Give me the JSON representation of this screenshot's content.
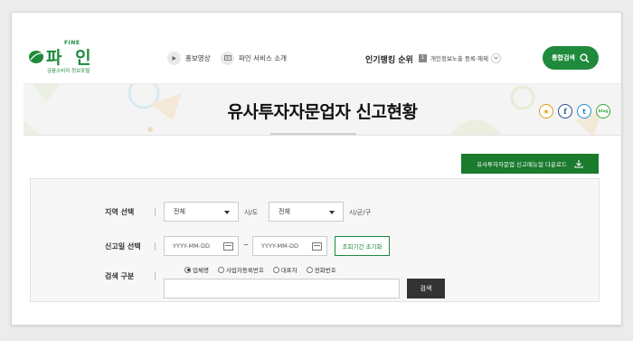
{
  "header": {
    "logo": {
      "small": "FINE",
      "main": "파 인",
      "sub": "금융소비자 정보포털"
    },
    "nav": [
      {
        "label": "홍보영상",
        "icon": "play-icon"
      },
      {
        "label": "파인 서비스 소개",
        "icon": "monitor-icon"
      }
    ],
    "ranking": {
      "title": "인기랭킹 순위",
      "rank": "1",
      "item": "개인정보노출 등록·해제"
    },
    "search_button": {
      "label": "통합검색",
      "icon": "search-icon"
    }
  },
  "banner": {
    "title": "유사투자자문업자 신고현황",
    "share": {
      "star": "★",
      "facebook": "f",
      "twitter": "t",
      "blog": "blog"
    }
  },
  "download_button": {
    "label": "유사투자자문업 신고매뉴얼 다운로드",
    "icon": "download-icon"
  },
  "form": {
    "region": {
      "label": "지역 선택",
      "city": {
        "value": "전체",
        "unit": "시/도"
      },
      "district": {
        "value": "전체",
        "unit": "시/군/구"
      }
    },
    "date": {
      "label": "신고일 선택",
      "start_placeholder": "YYYY-MM-DD",
      "tilde": "~",
      "end_placeholder": "YYYY-MM-DD",
      "reset_label": "조회기간 초기화"
    },
    "search": {
      "label": "검색 구분",
      "options": [
        "업체명",
        "사업자등록번호",
        "대표자",
        "전화번호"
      ],
      "selected": 0,
      "submit_label": "검색"
    }
  },
  "colors": {
    "brand": "#1f8a3c",
    "download": "#1a7a2e",
    "submit": "#333333"
  }
}
